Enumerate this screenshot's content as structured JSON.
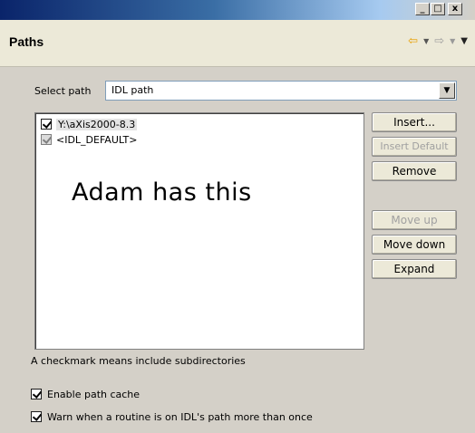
{
  "window": {
    "minimize_glyph": "_",
    "maximize_glyph": "□",
    "close_glyph": "x"
  },
  "header": {
    "title": "Paths",
    "nav_icons": [
      "back-arrow-icon",
      "dropdown-icon",
      "forward-arrow-icon",
      "dropdown-icon",
      "menu-icon"
    ]
  },
  "select_path": {
    "label": "Select path",
    "value": "IDL path"
  },
  "path_list": {
    "items": [
      {
        "label": "Y:\\aXis2000-8.3",
        "checked": true,
        "selected": true
      },
      {
        "label": "<IDL_DEFAULT>",
        "checked": true,
        "selected": false
      }
    ]
  },
  "annotation": "Adam has this",
  "buttons": {
    "insert": "Insert...",
    "insert_default": "Insert Default",
    "remove": "Remove",
    "move_up": "Move up",
    "move_down": "Move down",
    "expand": "Expand"
  },
  "hint": "A checkmark means include subdirectories",
  "options": {
    "enable_cache": {
      "label": "Enable path cache",
      "checked": true
    },
    "warn_duplicate": {
      "label": "Warn when a routine is on IDL's path more than once",
      "checked": true
    }
  }
}
